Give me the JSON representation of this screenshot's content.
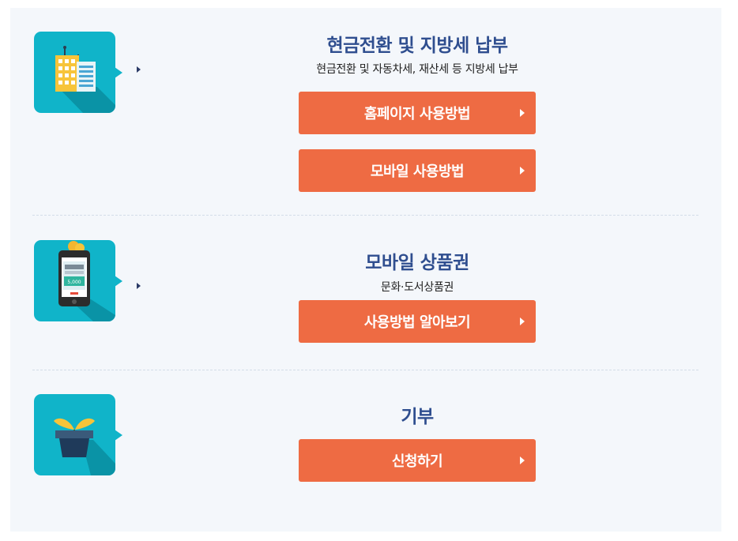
{
  "sections": [
    {
      "title": "현금전환 및 지방세 납부",
      "subtitle": "현금전환 및 자동차세, 재산세 등 지방세 납부",
      "buttons": [
        {
          "label": "홈페이지 사용방법"
        },
        {
          "label": "모바일 사용방법"
        }
      ],
      "icon": "building-icon"
    },
    {
      "title": "모바일 상품권",
      "subtitle": "문화·도서상품권",
      "buttons": [
        {
          "label": "사용방법 알아보기"
        }
      ],
      "icon": "smartphone-voucher-icon",
      "voucher_amount": "5,000"
    },
    {
      "title": "기부",
      "buttons": [
        {
          "label": "신청하기"
        }
      ],
      "icon": "sprout-pot-icon"
    }
  ],
  "colors": {
    "accent_button": "#ee6b43",
    "title": "#2f4e8f",
    "icon_bg": "#10b4c9",
    "panel_bg": "#f4f7fb"
  }
}
